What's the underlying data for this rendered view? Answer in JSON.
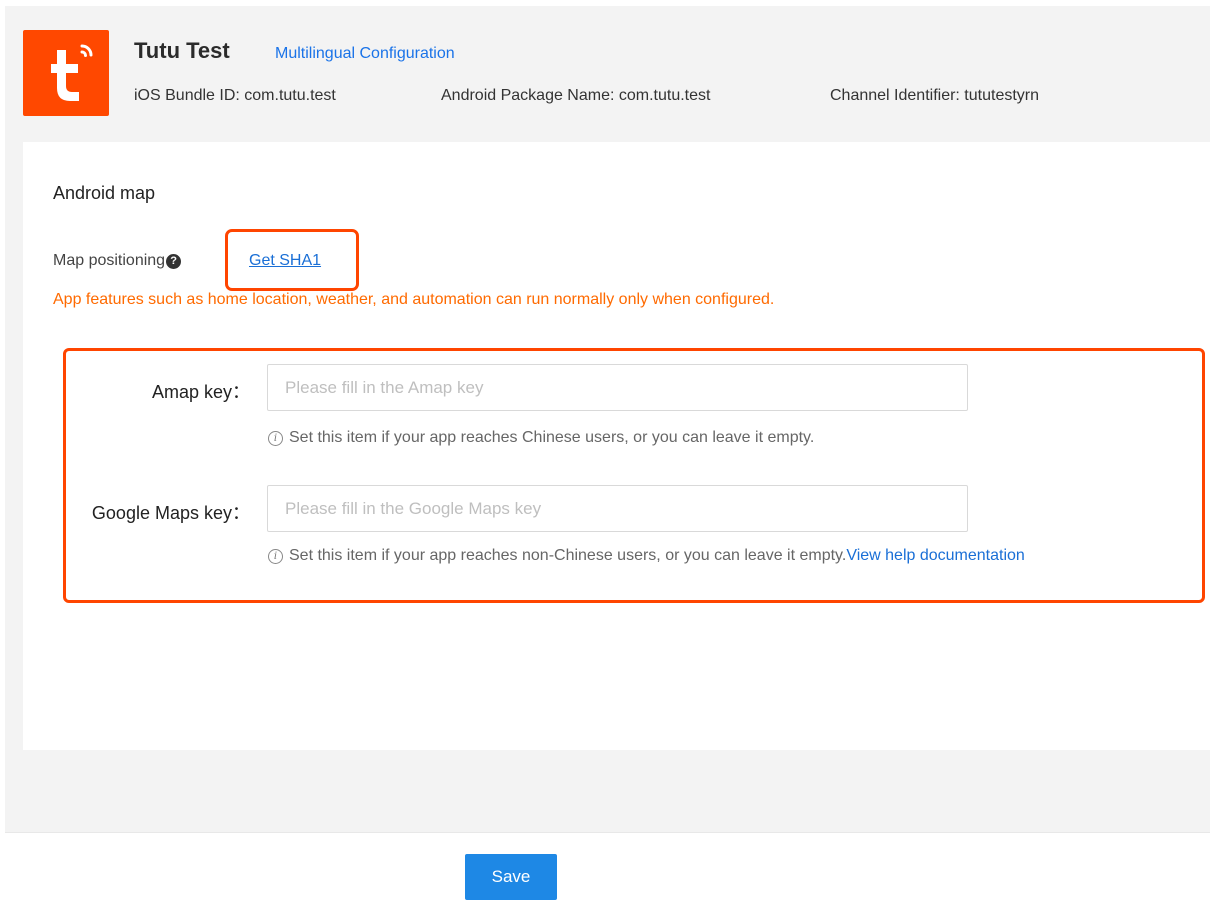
{
  "header": {
    "app_name": "Tutu Test",
    "multilingual_link": "Multilingual Configuration",
    "ios_bundle": "iOS Bundle ID: com.tutu.test",
    "android_package": "Android Package Name: com.tutu.test",
    "channel_identifier": "Channel Identifier: tututestyrn",
    "logo_icon": "tuya-smart-logo-icon",
    "logo_color": "#ff4800"
  },
  "section": {
    "title": "Android map",
    "map_positioning_label": "Map positioning",
    "help_icon": "question-circle-icon",
    "get_sha1_link": "Get SHA1",
    "warning": "App features such as home location, weather, and automation can run normally only when configured."
  },
  "amap": {
    "label": "Amap key：",
    "placeholder": "Please fill in the Amap key",
    "value": "",
    "hint": "Set this item if your app reaches Chinese users, or you can leave it empty."
  },
  "google": {
    "label": "Google Maps key：",
    "placeholder": "Please fill in the Google Maps key",
    "value": "",
    "hint": "Set this item if your app reaches non-Chinese users, or you can leave it empty.",
    "help_link": "View help documentation"
  },
  "info_icon": "info-circle-icon",
  "footer": {
    "save_label": "Save"
  },
  "colors": {
    "accent": "#1e88e5",
    "link": "#1a6fd6",
    "warning": "#ff6a00",
    "highlight": "#ff4500"
  }
}
